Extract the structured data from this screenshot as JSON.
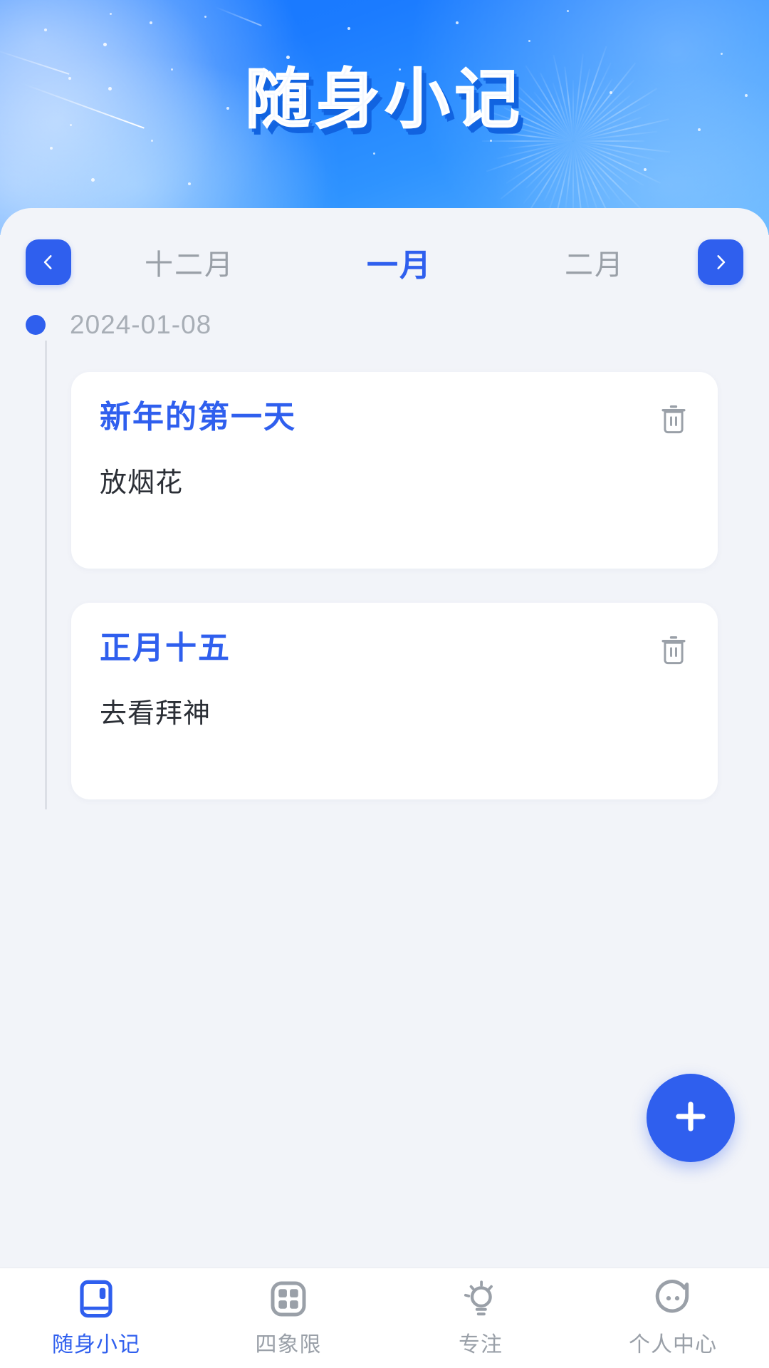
{
  "header": {
    "title": "随身小记",
    "gradient_from": "#1677FF",
    "gradient_to": "#5FB4FF",
    "title_color": "#F4F8FF",
    "title_shadow_color": "#1163E0"
  },
  "month_selector": {
    "prev_icon": "chevron-left-icon",
    "next_icon": "chevron-right-icon",
    "accent_color": "#2F5FEE",
    "inactive_color": "#9AA0A8",
    "months": [
      {
        "label": "十二月",
        "active": false
      },
      {
        "label": "一月",
        "active": true
      },
      {
        "label": "二月",
        "active": false
      }
    ]
  },
  "timeline": {
    "groups": [
      {
        "date": "2024-01-08",
        "dot_color": "#2F5FEE",
        "notes": [
          {
            "title": "新年的第一天",
            "body": "放烟花",
            "delete_icon": "trash-icon"
          },
          {
            "title": "正月十五",
            "body": "去看拜神",
            "delete_icon": "trash-icon"
          }
        ]
      }
    ]
  },
  "fab": {
    "icon": "plus-icon",
    "color": "#2F5FEE"
  },
  "tabbar": {
    "active_color": "#2F5FEE",
    "inactive_color": "#9AA0A8",
    "tabs": [
      {
        "label": "随身小记",
        "icon": "notebook-icon",
        "active": true
      },
      {
        "label": "四象限",
        "icon": "quadrant-grid-icon",
        "active": false
      },
      {
        "label": "专注",
        "icon": "lightbulb-icon",
        "active": false
      },
      {
        "label": "个人中心",
        "icon": "person-face-icon",
        "active": false
      }
    ]
  }
}
